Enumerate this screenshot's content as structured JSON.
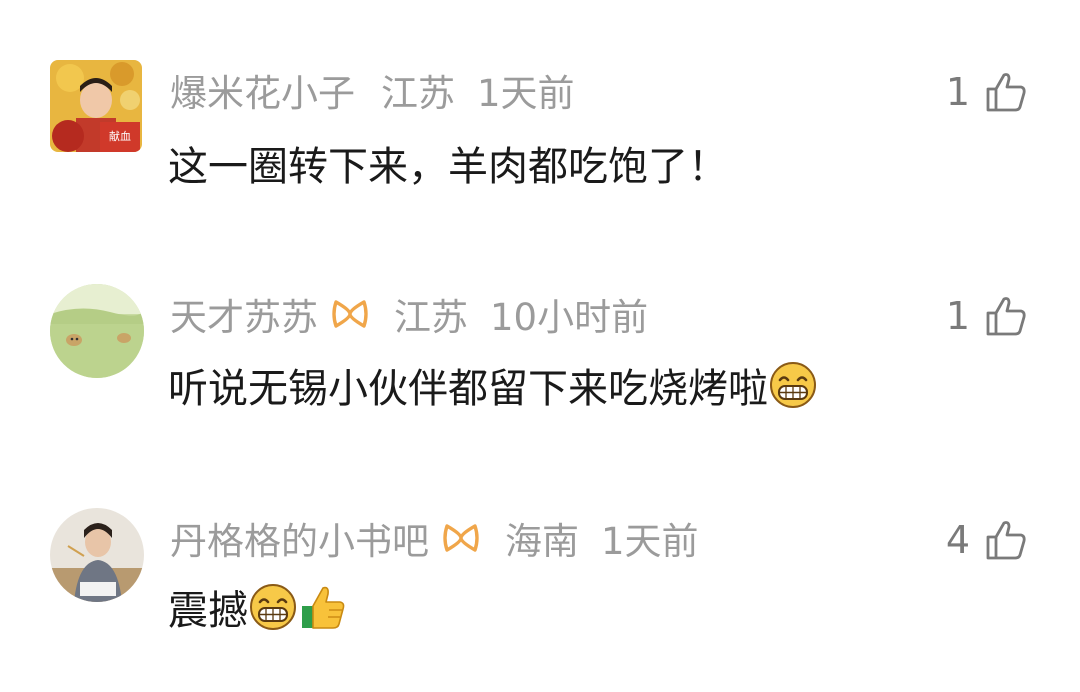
{
  "comments": [
    {
      "username": "爆米花小子",
      "location": "江苏",
      "time": "1天前",
      "text": "这一圈转下来，羊肉都吃饱了！",
      "likes": "1",
      "vip": false
    },
    {
      "username": "天才苏苏",
      "location": "江苏",
      "time": "10小时前",
      "text": "听说无锡小伙伴都留下来吃烧烤啦",
      "likes": "1",
      "vip": true
    },
    {
      "username": "丹格格的小书吧",
      "location": "海南",
      "time": "1天前",
      "text": "震撼",
      "likes": "4",
      "vip": true
    }
  ],
  "avatars": [
    {
      "badge_text": "献血"
    }
  ],
  "colors": {
    "meta_text": "#9b9b9b",
    "body_text": "#1a1a1a",
    "vip_icon": "#f0a64a",
    "emoji_yellow": "#f7c948"
  },
  "icons": [
    "thumbs-up-outline-icon",
    "vip-ribbon-icon",
    "grin-emoji",
    "thumbs-up-emoji"
  ]
}
